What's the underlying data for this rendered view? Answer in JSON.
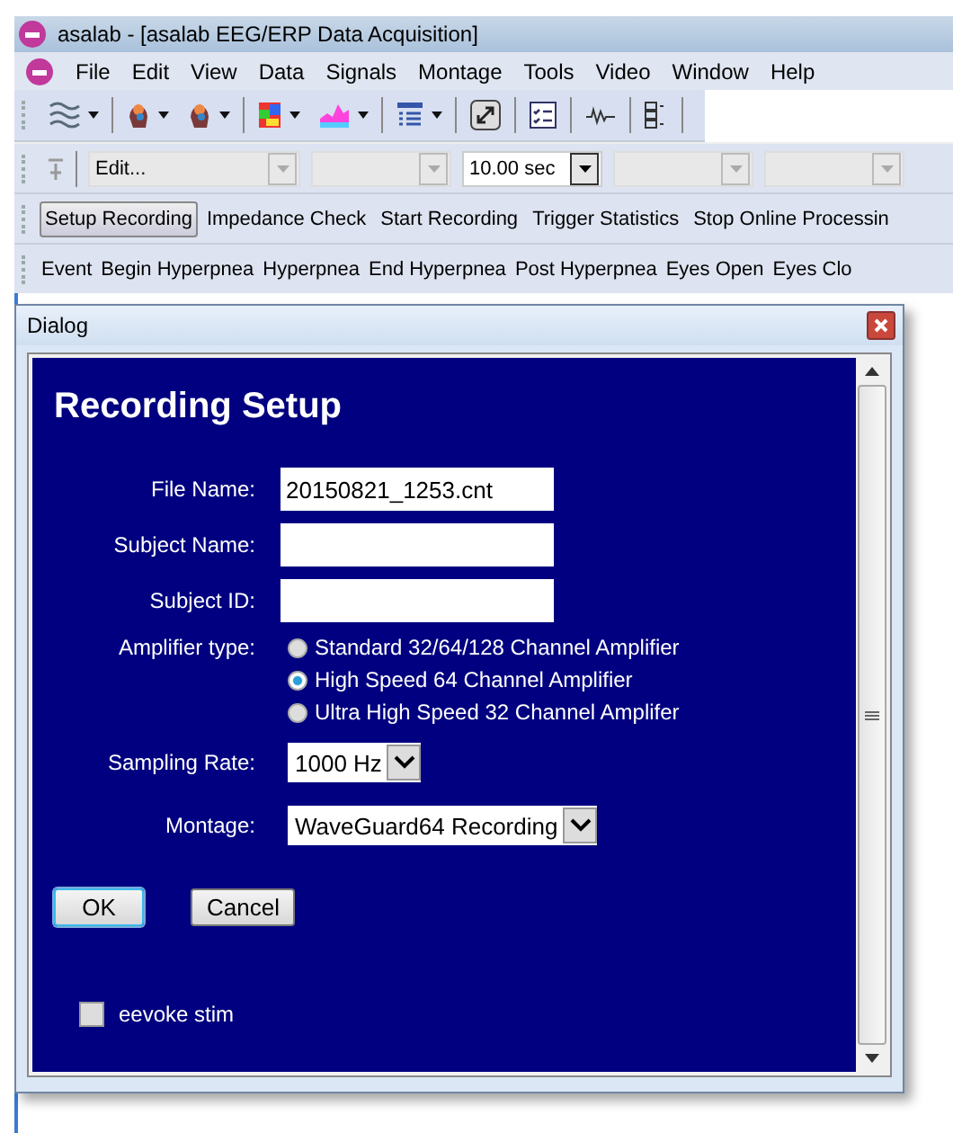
{
  "window": {
    "title": "asalab - [asalab EEG/ERP Data Acquisition]"
  },
  "menu": [
    "File",
    "Edit",
    "View",
    "Data",
    "Signals",
    "Montage",
    "Tools",
    "Video",
    "Window",
    "Help"
  ],
  "toolbar": [
    {
      "kind": "wave",
      "dropdown": true
    },
    {
      "kind": "head",
      "dropdown": true
    },
    {
      "kind": "head",
      "dropdown": true
    },
    {
      "kind": "map",
      "dropdown": true
    },
    {
      "kind": "spectrum",
      "dropdown": true
    },
    {
      "kind": "list",
      "dropdown": true
    },
    {
      "kind": "fullscreen",
      "dropdown": false
    },
    {
      "kind": "checklist",
      "dropdown": false
    },
    {
      "kind": "signal",
      "dropdown": false
    },
    {
      "kind": "tree",
      "dropdown": false
    }
  ],
  "combos": [
    {
      "kind": "greyed",
      "value": "Edit..."
    },
    {
      "kind": "greyed"
    },
    {
      "kind": "active",
      "value": "10.00 sec"
    },
    {
      "kind": "greyed"
    },
    {
      "kind": "greyed"
    }
  ],
  "actions": [
    {
      "label": "Setup Recording",
      "selected": true
    },
    {
      "label": "Impedance Check",
      "selected": false
    },
    {
      "label": "Start Recording",
      "selected": false
    },
    {
      "label": "Trigger Statistics",
      "selected": false
    },
    {
      "label": "Stop Online Processin",
      "selected": false
    }
  ],
  "events": [
    "Event",
    "Begin Hyperpnea",
    "Hyperpnea",
    "End Hyperpnea",
    "Post Hyperpnea",
    "Eyes Open",
    "Eyes Clo"
  ],
  "dialog": {
    "title": "Dialog",
    "heading": "Recording Setup",
    "fields": [
      {
        "label": "File Name:",
        "value": "20150821_1253.cnt"
      },
      {
        "label": "Subject Name:"
      },
      {
        "label": "Subject ID:"
      }
    ],
    "amplifier": {
      "label": "Amplifier type:",
      "options": [
        {
          "label": "Standard 32/64/128 Channel Amplifier",
          "selected": false
        },
        {
          "label": "High Speed 64 Channel Amplifier",
          "selected": true
        },
        {
          "label": "Ultra High Speed 32 Channel Amplifer",
          "selected": false
        }
      ]
    },
    "selects": [
      {
        "label": "Sampling Rate:",
        "value": "1000 Hz"
      },
      {
        "label": "Montage:",
        "value": "WaveGuard64 Recording"
      }
    ],
    "buttons": [
      {
        "label": "OK",
        "focused": true
      },
      {
        "label": "Cancel",
        "focused": false
      }
    ],
    "checkbox": {
      "label": "eevoke stim",
      "checked": false
    }
  }
}
